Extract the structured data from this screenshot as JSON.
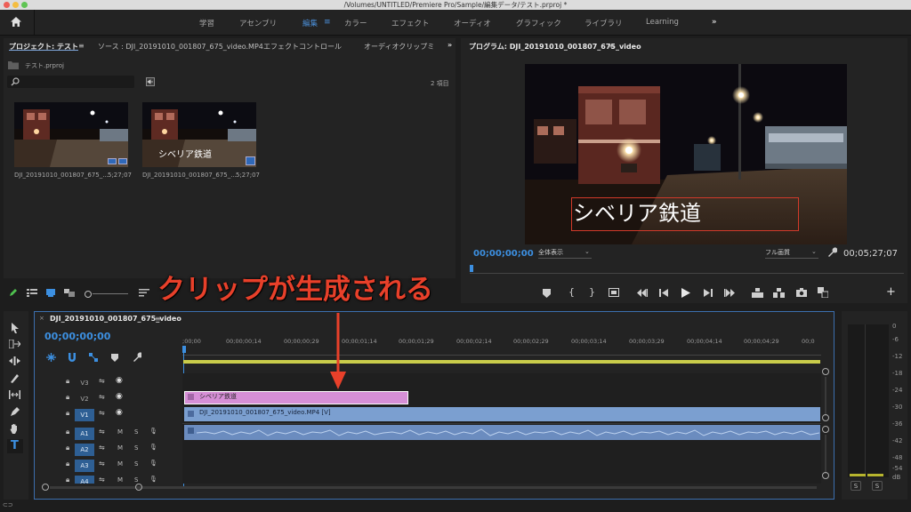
{
  "window": {
    "title": "/Volumes/UNTITLED/Premiere Pro/Sample/編集データ/テスト.prproj *"
  },
  "workspaces": {
    "items": [
      "学習",
      "アセンブリ",
      "編集",
      "カラー",
      "エフェクト",
      "オーディオ",
      "グラフィック",
      "ライブラリ",
      "Learning"
    ],
    "active": "編集"
  },
  "project_panel": {
    "tabs": [
      "プロジェクト: テスト",
      "ソース : DJI_20191010_001807_675_video.MP4",
      "エフェクトコントロール",
      "オーディオクリップミ"
    ],
    "bin": "テスト.prproj",
    "search": {
      "value": "",
      "placeholder": ""
    },
    "item_count": "2 項目",
    "items": [
      {
        "name": "DJI_20191010_001807_675_...",
        "duration": "5;27;07"
      },
      {
        "name": "DJI_20191010_001807_675_...",
        "duration": "5;27;07",
        "overlay": "シベリア鉄道"
      }
    ]
  },
  "program_monitor": {
    "tab": "プログラム: DJI_20191010_001807_675_video",
    "title_text": "シベリア鉄道",
    "timecode": "00;00;00;00",
    "zoom": "全体表示",
    "quality": "フル画質",
    "duration": "00;05;27;07"
  },
  "annotation": {
    "text": "クリップが生成される",
    "color": "#e8402a"
  },
  "timeline": {
    "sequence_tab": "DJI_20191010_001807_675_video",
    "timecode": "00;00;00;00",
    "ruler": [
      ";00;00",
      "00;00;00;14",
      "00;00;00;29",
      "00;00;01;14",
      "00;00;01;29",
      "00;00;02;14",
      "00;00;02;29",
      "00;00;03;14",
      "00;00;03;29",
      "00;00;04;14",
      "00;00;04;29",
      "00;0"
    ],
    "video_tracks": [
      "V3",
      "V2",
      "V1"
    ],
    "audio_tracks": [
      "A1",
      "A2",
      "A3",
      "A4"
    ],
    "track_buttons": {
      "mute": "M",
      "solo": "S"
    },
    "clips": {
      "graphic": {
        "label": "シベリア鉄道",
        "color": "#d68fd6"
      },
      "video": {
        "label": "DJI_20191010_001807_675_video.MP4 [V]",
        "color": "#7b9fd0"
      },
      "audio": {
        "color": "#6b8cbf"
      }
    }
  },
  "meter": {
    "scale": [
      "0",
      "-6",
      "-12",
      "-18",
      "-24",
      "-30",
      "-36",
      "-42",
      "-48",
      "-54",
      "dB"
    ],
    "solo": [
      "S",
      "S"
    ]
  }
}
